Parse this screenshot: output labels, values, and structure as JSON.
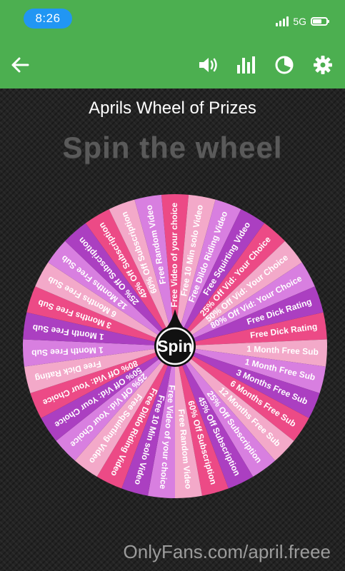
{
  "status_bar": {
    "time": "8:26",
    "network": "5G"
  },
  "toolbar": {
    "back_icon": "arrow-left-icon",
    "sound_icon": "speaker-icon",
    "stats_icon": "bar-chart-icon",
    "pie_icon": "pie-chart-icon",
    "settings_icon": "gear-icon"
  },
  "wheel_title": "Aprils Wheel of Prizes",
  "spin_heading": "Spin the wheel",
  "spin_button_label": "Spin",
  "colors": {
    "status_bar": "#4caf50",
    "segment_a": "#ec4a86",
    "segment_b": "#f3a9c9",
    "segment_c": "#d87fe0",
    "segment_d": "#ab3fc1",
    "hub": "#111111"
  },
  "wheel_entries": [
    "Free Video of your choice",
    "Free 10 Min solo Video",
    "Free Dildo Riding Video",
    "Free Squirting Video",
    "25% Off Vid: Your Choice",
    "50% Off Vid: Your Choice",
    "80% Off Vid: Your Choice",
    "Free Dick Rating",
    "Free Dick Rating",
    "1 Month Free Sub",
    "1 Month Free Sub",
    "3 Months Free Sub",
    "6 Months Free Sub",
    "12 Months Free Sub",
    "25% Off Subscription",
    "45% Off Subscription",
    "60% Off Subscription",
    "Free Random Video",
    "Free Video of your choice",
    "Free 10 Min solo Video",
    "Free Dildo Riding Video",
    "Free Squirting Video",
    "25% Off Vid: Your Choice",
    "50% Off Vid: Your Choice",
    "80% Off Vid: Your Choice",
    "Free Dick Rating",
    "1 Month Free Sub",
    "1 Month Free Sub",
    "3 Months Free Sub",
    "6 Months Free Sub",
    "12 Months Free Sub",
    "25% Off Subscription",
    "45% Off Subscription",
    "60% Off Subscription",
    "Free Random Video"
  ],
  "watermark": "OnlyFans.com/april.freee"
}
